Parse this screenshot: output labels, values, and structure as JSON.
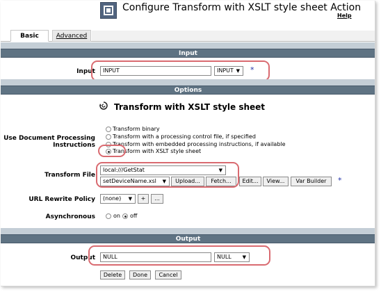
{
  "header": {
    "title": "Configure Transform with XSLT style sheet Action",
    "help_link": "Help",
    "logo_icon": "action-config-icon"
  },
  "tabs": [
    {
      "label": "Basic",
      "active": true
    },
    {
      "label": "Advanced",
      "active": false
    }
  ],
  "input_section": {
    "heading": "Input",
    "label": "Input",
    "value": "INPUT",
    "dropdown": "INPUT",
    "required_marker": "*"
  },
  "options_section": {
    "heading": "Options",
    "action_title": "Transform with XSLT style sheet",
    "action_icon": "transform-icon",
    "doc_processing": {
      "label_line1": "Use Document Processing",
      "label_line2": "Instructions",
      "options": [
        {
          "label": "Transform binary",
          "selected": false
        },
        {
          "label": "Transform with a processing control file, if specified",
          "selected": false
        },
        {
          "label": "Transform with embedded processing instructions, if available",
          "selected": false
        },
        {
          "label": "Transform with XSLT style sheet",
          "selected": true
        }
      ]
    },
    "transform_file": {
      "label": "Transform File",
      "location": "local:///GetStat",
      "file": "setDeviceName.xsl",
      "buttons": [
        "Upload...",
        "Fetch...",
        "Edit...",
        "View...",
        "Var Builder"
      ],
      "required_marker": "*"
    },
    "url_rewrite": {
      "label": "URL Rewrite Policy",
      "value": "(none)",
      "add_button": "+",
      "more_button": "..."
    },
    "asynchronous": {
      "label": "Asynchronous",
      "on_label": "on",
      "off_label": "off",
      "selected": "off"
    }
  },
  "output_section": {
    "heading": "Output",
    "label": "Output",
    "value": "NULL",
    "dropdown": "NULL"
  },
  "footer": {
    "delete": "Delete",
    "done": "Done",
    "cancel": "Cancel"
  },
  "colors": {
    "section_bar": "#5f7383",
    "highlight": "#d96a70",
    "required": "#2132a8"
  }
}
